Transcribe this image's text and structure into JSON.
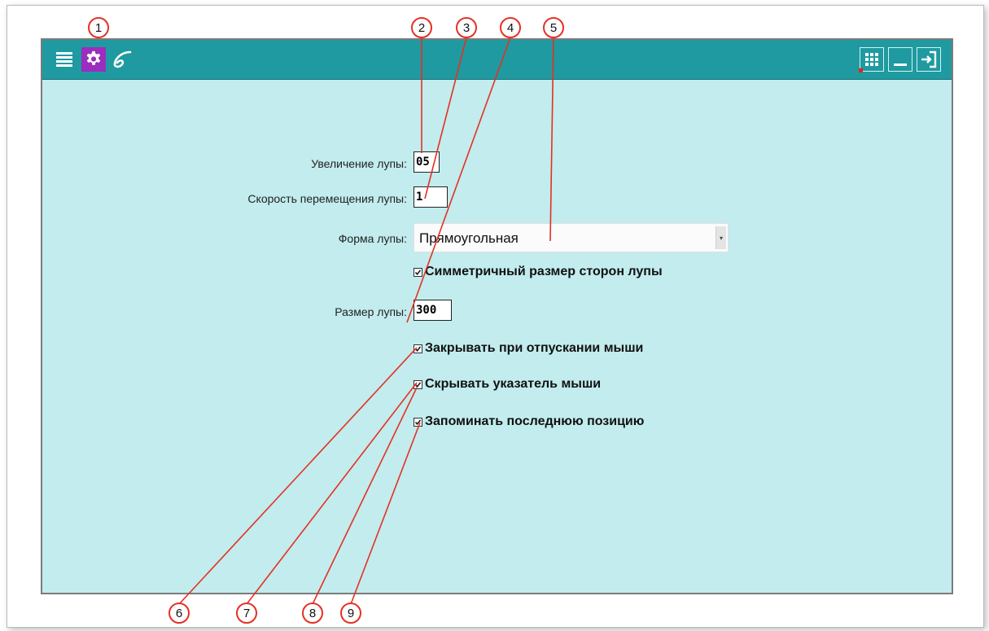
{
  "toolbar": {
    "left_buttons": [
      {
        "icon": "list-icon"
      },
      {
        "icon": "gear-icon",
        "active": true
      },
      {
        "icon": "logo-icon"
      }
    ],
    "right_buttons": [
      {
        "icon": "grid-icon"
      },
      {
        "icon": "minimize-icon"
      },
      {
        "icon": "exit-icon"
      }
    ]
  },
  "form": {
    "zoom_label": "Увеличение лупы:",
    "zoom_value": "05",
    "speed_label": "Скорость перемещения лупы:",
    "speed_value": "1",
    "shape_label": "Форма лупы:",
    "shape_value": "Прямоугольная",
    "symmetric_label": "Симметричный размер сторон лупы",
    "symmetric_checked": true,
    "size_label": "Размер лупы:",
    "size_value": "300",
    "close_on_release_label": "Закрывать при отпускании мыши",
    "close_on_release_checked": true,
    "hide_cursor_label": "Скрывать указатель мыши",
    "hide_cursor_checked": true,
    "remember_position_label": "Запоминать последнюю позицию",
    "remember_position_checked": true
  },
  "callouts": [
    "1",
    "2",
    "3",
    "4",
    "5",
    "6",
    "7",
    "8",
    "9"
  ],
  "colors": {
    "titlebar": "#1f9aa0",
    "panel_background": "#c2eced",
    "active_button": "#9b2dbf",
    "callout_red": "#e53024"
  }
}
